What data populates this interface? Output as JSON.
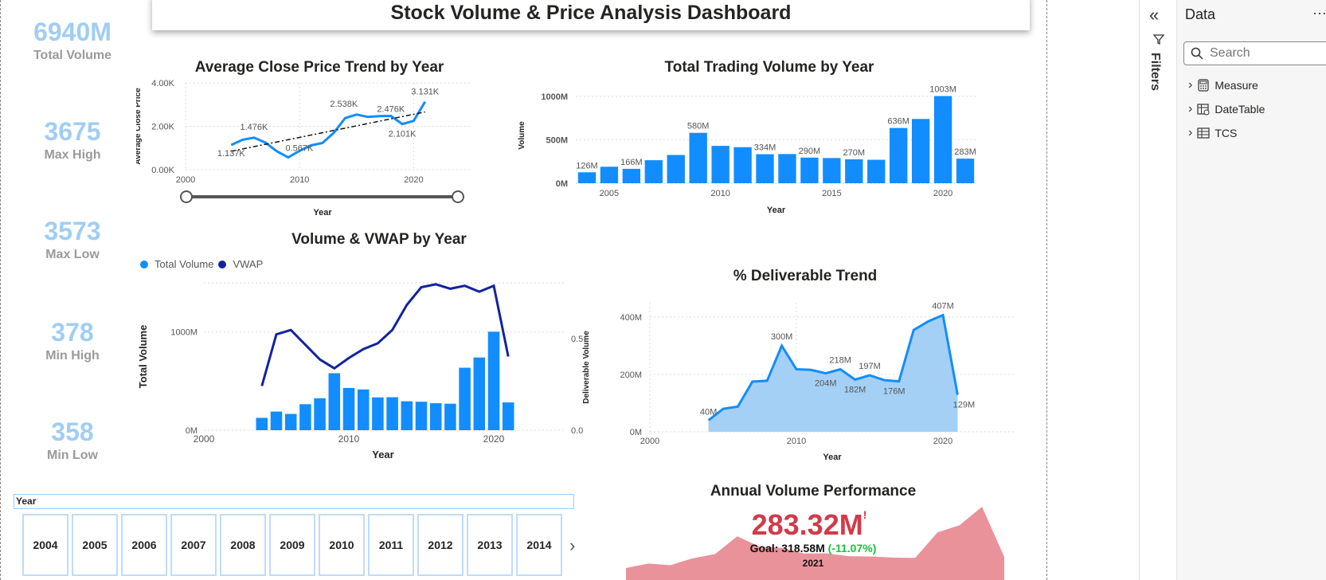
{
  "title": "Stock Volume & Price Analysis Dashboard",
  "kpis": [
    {
      "value": "6940M",
      "label": "Total Volume"
    },
    {
      "value": "3675",
      "label": "Max High"
    },
    {
      "value": "3573",
      "label": "Max Low"
    },
    {
      "value": "378",
      "label": "Min High"
    },
    {
      "value": "358",
      "label": "Min Low"
    }
  ],
  "charts": {
    "avg_close": {
      "title": "Average Close Price Trend by Year",
      "ylabel": "Average Close Price",
      "xlabel": "Year"
    },
    "total_volume": {
      "title": "Total Trading Volume by Year",
      "ylabel": "Volume",
      "xlabel": "Year"
    },
    "vwap": {
      "title": "Volume & VWAP by Year",
      "ylabel": "Total Volume",
      "xlabel": "Year",
      "legend": [
        "Total Volume",
        "VWAP"
      ]
    },
    "deliverable": {
      "title": "% Deliverable Trend",
      "ylabel": "Deliverable Volume",
      "xlabel": "Year"
    },
    "annual": {
      "title": "Annual Volume Performance"
    }
  },
  "chart_data": [
    {
      "type": "line",
      "title": "Average Close Price Trend by Year",
      "xlabel": "Year",
      "ylabel": "Average Close Price",
      "x": [
        2004,
        2005,
        2006,
        2007,
        2008,
        2009,
        2010,
        2011,
        2012,
        2013,
        2014,
        2015,
        2016,
        2017,
        2018,
        2019,
        2020,
        2021
      ],
      "values": [
        1137,
        1380,
        1476,
        1250,
        850,
        567,
        870,
        1120,
        1230,
        1700,
        2380,
        2538,
        2430,
        2470,
        2476,
        2101,
        2250,
        3131
      ],
      "point_labels": {
        "2004": "1.137K",
        "2006": "1.476K",
        "2009": "0.567K",
        "2015": "2.538K",
        "2018": "2.476K",
        "2019": "2.101K",
        "2021": "3.131K"
      },
      "trendline": [
        [
          2004,
          850
        ],
        [
          2021,
          2660
        ]
      ],
      "xlim": [
        2000,
        2025
      ],
      "ylim": [
        0,
        4000
      ],
      "yticks": [
        "0.00K",
        "2.00K",
        "4.00K"
      ],
      "xticks": [
        "2000",
        "2010",
        "2020"
      ]
    },
    {
      "type": "bar",
      "title": "Total Trading Volume by Year",
      "xlabel": "Year",
      "ylabel": "Volume",
      "x": [
        2004,
        2005,
        2006,
        2007,
        2008,
        2009,
        2010,
        2011,
        2012,
        2013,
        2014,
        2015,
        2016,
        2017,
        2018,
        2019,
        2020,
        2021
      ],
      "values": [
        126,
        190,
        166,
        265,
        325,
        580,
        430,
        415,
        334,
        336,
        295,
        290,
        275,
        270,
        636,
        740,
        1003,
        283
      ],
      "point_labels": {
        "2004": "126M",
        "2006": "166M",
        "2009": "580M",
        "2012": "334M",
        "2014": "290M",
        "2016": "270M",
        "2018": "636M",
        "2020": "1003M",
        "2021": "283M"
      },
      "ylim": [
        0,
        1100
      ],
      "yticks": [
        "0M",
        "500M",
        "1000M"
      ],
      "xticks": [
        "2005",
        "2010",
        "2015",
        "2020"
      ]
    },
    {
      "type": "bar",
      "title": "Volume & VWAP by Year",
      "xlabel": "Year",
      "ylabel": "Total Volume",
      "x": [
        2004,
        2005,
        2006,
        2007,
        2008,
        2009,
        2010,
        2011,
        2012,
        2013,
        2014,
        2015,
        2016,
        2017,
        2018,
        2019,
        2020,
        2021
      ],
      "series": [
        {
          "name": "Total Volume",
          "values": [
            126,
            190,
            166,
            265,
            325,
            580,
            430,
            415,
            334,
            336,
            295,
            290,
            275,
            270,
            636,
            740,
            1003,
            283
          ]
        },
        {
          "name": "VWAP",
          "values": [
            0.3,
            0.65,
            0.68,
            0.58,
            0.48,
            0.42,
            0.49,
            0.55,
            0.59,
            0.68,
            0.85,
            0.97,
            0.99,
            0.96,
            0.98,
            0.94,
            0.98,
            0.5
          ]
        }
      ],
      "xlim": [
        2000,
        2025
      ],
      "ylim": [
        0,
        1500
      ],
      "yticks": [
        "0M",
        "1000M"
      ],
      "xticks": [
        "2000",
        "2010",
        "2020"
      ]
    },
    {
      "type": "area",
      "title": "% Deliverable Trend",
      "xlabel": "Year",
      "ylabel": "Deliverable Volume",
      "x": [
        2004,
        2005,
        2006,
        2007,
        2008,
        2009,
        2010,
        2011,
        2012,
        2013,
        2014,
        2015,
        2016,
        2017,
        2018,
        2019,
        2020,
        2021
      ],
      "values": [
        40,
        80,
        88,
        175,
        178,
        300,
        218,
        216,
        204,
        218,
        182,
        197,
        180,
        176,
        355,
        385,
        407,
        129
      ],
      "point_labels": {
        "2004": "40M",
        "2009": "300M",
        "2012": "204M",
        "2013": "218M",
        "2014": "182M",
        "2015": "197M",
        "2017": "176M",
        "2020": "407M",
        "2021": "129M"
      },
      "xlim": [
        2000,
        2025
      ],
      "ylim": [
        0,
        450
      ],
      "yticks": [
        "0M",
        "200M",
        "400M"
      ],
      "xticks": [
        "2000",
        "2010",
        "2020"
      ]
    },
    {
      "type": "area",
      "title": "Annual Volume Performance",
      "values": [
        126,
        190,
        166,
        265,
        325,
        580,
        430,
        415,
        334,
        336,
        295,
        290,
        275,
        270,
        636,
        740,
        1003,
        283
      ],
      "kpi_value": "283.32M",
      "goal": "Goal: 318.58M",
      "delta": "(-11.07%)",
      "year": "2021"
    }
  ],
  "slicer": {
    "header": "Year",
    "years": [
      "2004",
      "2005",
      "2006",
      "2007",
      "2008",
      "2009",
      "2010",
      "2011",
      "2012",
      "2013",
      "2014"
    ],
    "next_icon": "chevron-right-icon"
  },
  "panes": {
    "filters_label": "Filters",
    "data_title": "Data",
    "search_placeholder": "Search",
    "tables": [
      "Measure",
      "DateTable",
      "TCS"
    ]
  },
  "colors": {
    "primary": "#118dff",
    "dark": "#12239e",
    "light": "#a0cdf4",
    "kpi_red": "#d13a4a",
    "kpi_green": "#19c23c"
  }
}
